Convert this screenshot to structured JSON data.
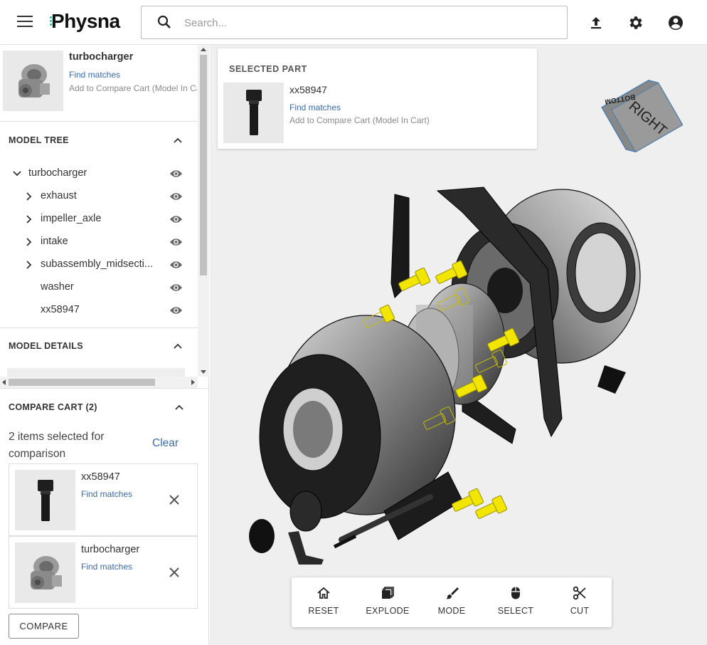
{
  "header": {
    "logo": "Physna",
    "search_placeholder": "Search...",
    "icons": [
      "menu-icon",
      "search-icon",
      "upload-icon",
      "gear-icon",
      "account-icon"
    ]
  },
  "model_card": {
    "title": "turbocharger",
    "find_matches": "Find matches",
    "add_to_cart": "Add to Compare Cart (Model In Cart)"
  },
  "model_tree": {
    "title": "MODEL TREE",
    "root": "turbocharger",
    "items": [
      {
        "label": "exhaust",
        "expandable": true
      },
      {
        "label": "impeller_axle",
        "expandable": true
      },
      {
        "label": "intake",
        "expandable": true
      },
      {
        "label": "subassembly_midsecti...",
        "expandable": true
      },
      {
        "label": "washer",
        "expandable": false
      },
      {
        "label": "xx58947",
        "expandable": false
      }
    ]
  },
  "model_details": {
    "title": "MODEL DETAILS"
  },
  "compare_cart": {
    "title": "COMPARE CART (2)",
    "count_text": "2 items selected for comparison",
    "clear_label": "Clear",
    "items": [
      {
        "name": "xx58947",
        "find_matches": "Find matches"
      },
      {
        "name": "turbocharger",
        "find_matches": "Find matches"
      }
    ],
    "compare_label": "COMPARE"
  },
  "selected_part": {
    "heading": "SELECTED PART",
    "name": "xx58947",
    "find_matches": "Find matches",
    "add_to_cart": "Add to Compare Cart (Model In Cart)"
  },
  "view_cube": {
    "front": "RIGHT",
    "bottom": "BOTTOM"
  },
  "toolbar": {
    "reset": "RESET",
    "explode": "EXPLODE",
    "mode": "MODE",
    "select": "SELECT",
    "cut": "CUT"
  },
  "colors": {
    "link": "#3a6aa8",
    "highlight": "#f2e600",
    "logo_accent": "#1fbf9c"
  }
}
